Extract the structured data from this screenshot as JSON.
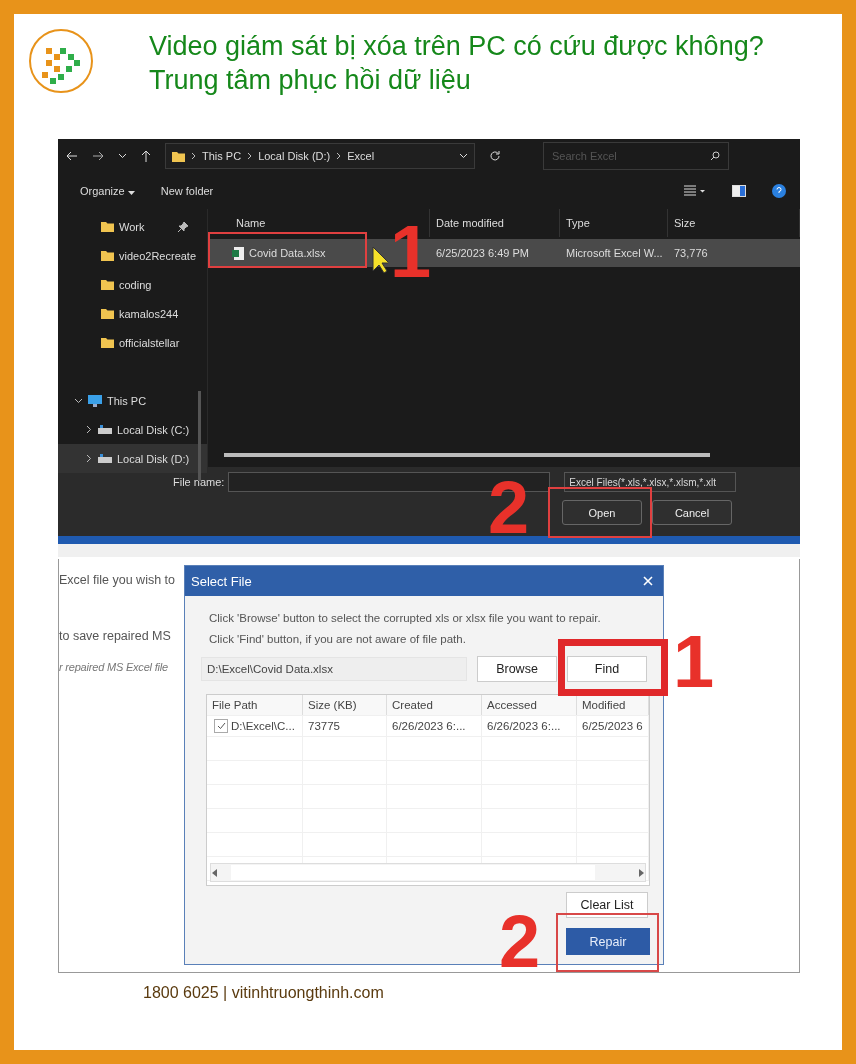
{
  "header": {
    "title": "Video giám sát bị xóa trên PC có cứu được không? Trung tâm phục hồi dữ liệu"
  },
  "explorer": {
    "breadcrumb": [
      "This PC",
      "Local Disk (D:)",
      "Excel"
    ],
    "search": {
      "placeholder": "Search Excel"
    },
    "toolbar": [
      "Organize",
      "New folder"
    ],
    "nav": [
      {
        "label": "Work",
        "kind": "folder",
        "pinned": true,
        "selected": false
      },
      {
        "label": "video2Recreate",
        "kind": "folder",
        "pinned": false,
        "selected": false
      },
      {
        "label": "coding",
        "kind": "folder",
        "pinned": false,
        "selected": false
      },
      {
        "label": "kamalos244",
        "kind": "folder",
        "pinned": false,
        "selected": false
      },
      {
        "label": "officialstellar",
        "kind": "folder",
        "pinned": false,
        "selected": false
      },
      {
        "label": "This PC",
        "kind": "pc",
        "expanded": true,
        "pinned": false,
        "selected": false
      },
      {
        "label": "Local Disk (C:)",
        "kind": "drive",
        "expanded": false,
        "pinned": false,
        "selected": false
      },
      {
        "label": "Local Disk (D:)",
        "kind": "drive",
        "expanded": false,
        "pinned": false,
        "selected": true
      }
    ],
    "columns": [
      "Name",
      "Date modified",
      "Type",
      "Size"
    ],
    "files": [
      {
        "name": "Covid Data.xlsx",
        "date": "6/25/2023 6:49 PM",
        "type": "Microsoft Excel W...",
        "size": "73,776",
        "selected": true
      }
    ],
    "file_name_label": "File name:",
    "filter": "Excel Files(*.xls,*.xlsx,*.xlsm,*.xlt",
    "buttons": [
      "Open",
      "Cancel"
    ],
    "markers": [
      {
        "label": "1"
      },
      {
        "label": "2"
      }
    ]
  },
  "repair": {
    "page_text": [
      {
        "text": "Excel file you wish to",
        "italic": false
      },
      {
        "text": "to save repaired MS",
        "italic": false
      },
      {
        "text": "r repaired MS Excel file",
        "italic": true
      }
    ],
    "dialog": {
      "title": "Select File",
      "instructions": [
        "Click 'Browse' button to select the corrupted xls or xlsx file you want to repair.",
        "Click 'Find' button, if you are not aware of file path."
      ],
      "path": "D:\\Excel\\Covid Data.xlsx",
      "buttons": [
        "Browse",
        "Find"
      ],
      "columns": [
        "File Path",
        "Size (KB)",
        "Created",
        "Accessed",
        "Modified"
      ],
      "rows": [
        {
          "checked": true,
          "cells": [
            "D:\\Excel\\C...",
            "73775",
            "6/26/2023 6:...",
            "6/26/2023 6:...",
            "6/25/2023 6"
          ]
        }
      ],
      "clear_button": "Clear List",
      "repair_button": "Repair"
    },
    "markers": [
      {
        "label": "1"
      },
      {
        "label": "2"
      }
    ]
  },
  "footer": {
    "text": "1800 6025 | vitinhtruongthinh.com"
  }
}
